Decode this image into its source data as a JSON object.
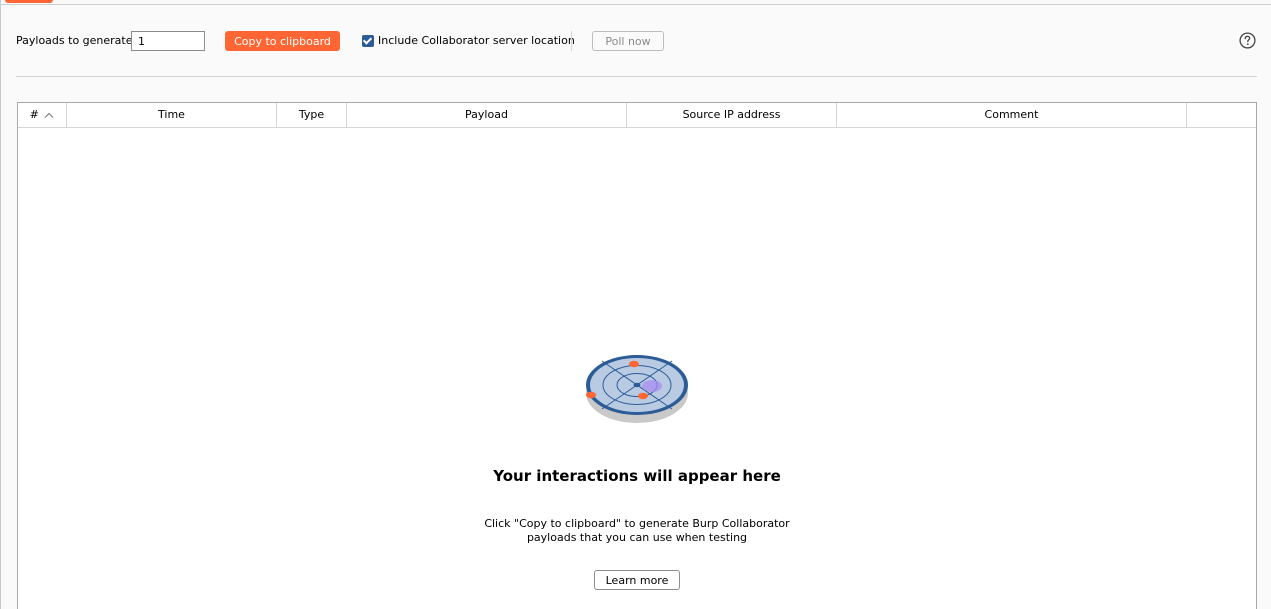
{
  "toolbar": {
    "payloads_label": "Payloads to generate:",
    "payloads_value": "1",
    "copy_button": "Copy to clipboard",
    "include_label": "Include Collaborator server location",
    "include_checked": true,
    "poll_button": "Poll now"
  },
  "table": {
    "columns": [
      "#",
      "Time",
      "Type",
      "Payload",
      "Source IP address",
      "Comment",
      ""
    ],
    "sort_column": "#",
    "sort_direction": "ascending",
    "rows": []
  },
  "empty_state": {
    "title": "Your interactions will appear here",
    "description": "Click \"Copy to clipboard\" to generate Burp Collaborator payloads that you can use when testing",
    "learn_more": "Learn more"
  },
  "colors": {
    "accent": "#ff6633",
    "checkbox": "#2b5c96",
    "radar_ring": "#2b5c96",
    "radar_fill": "#b9cbe3"
  }
}
